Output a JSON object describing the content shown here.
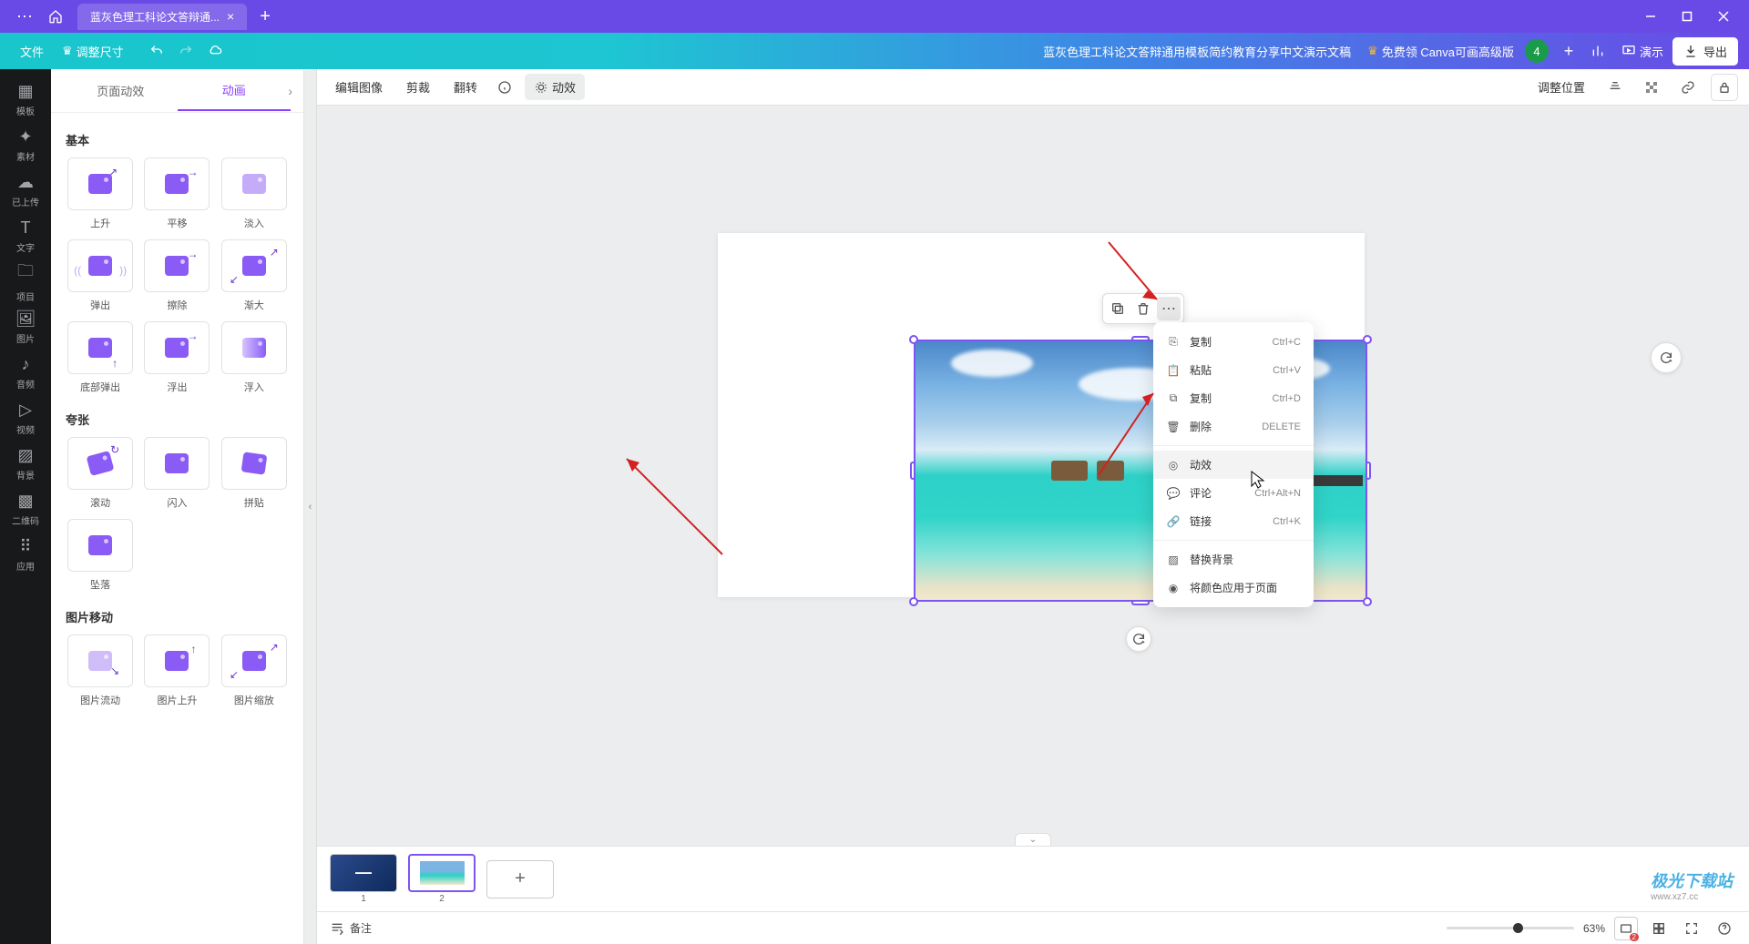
{
  "titlebar": {
    "tab_name": "蓝灰色理工科论文答辩通...",
    "tab_close": "×",
    "new_tab": "+"
  },
  "toolbar": {
    "file": "文件",
    "resize": "调整尺寸",
    "doc_title": "蓝灰色理工科论文答辩通用模板简约教育分享中文演示文稿",
    "upgrade": "免费领 Canva可画高级版",
    "avatar_initial": "4",
    "present": "演示",
    "export": "导出"
  },
  "rail": {
    "items": [
      {
        "label": "模板"
      },
      {
        "label": "素材"
      },
      {
        "label": "已上传"
      },
      {
        "label": "文字"
      },
      {
        "label": "项目"
      },
      {
        "label": "图片"
      },
      {
        "label": "音频"
      },
      {
        "label": "视频"
      },
      {
        "label": "背景"
      },
      {
        "label": "二维码"
      },
      {
        "label": "应用"
      }
    ]
  },
  "sidepanel": {
    "tab_page_anim": "页面动效",
    "tab_anim": "动画",
    "sections": {
      "basic": "基本",
      "exaggerate": "夸张",
      "image_motion": "图片移动"
    },
    "basic_items": [
      "上升",
      "平移",
      "淡入",
      "弹出",
      "擦除",
      "渐大",
      "底部弹出",
      "浮出",
      "浮入"
    ],
    "exaggerate_items": [
      "滚动",
      "闪入",
      "拼贴",
      "坠落"
    ],
    "image_motion_items": [
      "图片流动",
      "图片上升",
      "图片缩放"
    ]
  },
  "canvas_toolbar": {
    "edit_image": "编辑图像",
    "crop": "剪裁",
    "flip": "翻转",
    "effects": "动效",
    "position": "调整位置"
  },
  "context_menu": {
    "copy": {
      "label": "复制",
      "shortcut": "Ctrl+C"
    },
    "paste": {
      "label": "粘贴",
      "shortcut": "Ctrl+V"
    },
    "duplicate": {
      "label": "复制",
      "shortcut": "Ctrl+D"
    },
    "delete": {
      "label": "删除",
      "shortcut": "DELETE"
    },
    "effects": {
      "label": "动效",
      "shortcut": ""
    },
    "comment": {
      "label": "评论",
      "shortcut": "Ctrl+Alt+N"
    },
    "link": {
      "label": "链接",
      "shortcut": "Ctrl+K"
    },
    "replace_bg": {
      "label": "替换背景",
      "shortcut": ""
    },
    "apply_color": {
      "label": "将颜色应用于页面",
      "shortcut": ""
    }
  },
  "pages": {
    "page1_num": "1",
    "page2_num": "2"
  },
  "footer": {
    "notes": "备注",
    "zoom": "63%",
    "badge": "2"
  },
  "watermark": "极光下载站"
}
